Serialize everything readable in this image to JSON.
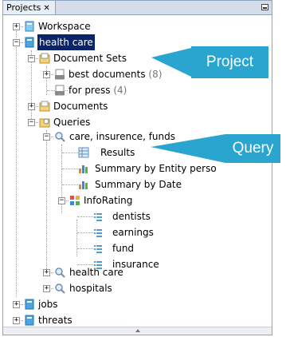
{
  "panel": {
    "tab_label": "Projects",
    "close_glyph": "✕"
  },
  "tree": {
    "workspace": "Workspace",
    "health_care": "health care",
    "document_sets": "Document Sets",
    "best_documents": "best documents",
    "best_documents_count": "(8)",
    "for_press": "for press",
    "for_press_count": "(4)",
    "documents": "Documents",
    "queries": "Queries",
    "query_name": "care, insurence, funds",
    "results": "Results",
    "summary_entity": "Summary by Entity perso",
    "summary_date": "Summary by Date",
    "inforating": "InfoRating",
    "dentists": "dentists",
    "earnings": "earnings",
    "fund": "fund",
    "insurance": "insurance",
    "query_health_care": "health care",
    "query_hospitals": "hospitals",
    "jobs": "jobs",
    "threats": "threats"
  },
  "callouts": {
    "project": "Project",
    "query": "Query"
  },
  "icons": {
    "project": "project-book-icon",
    "folder": "folder-icon",
    "document_set": "document-set-icon",
    "search": "search-icon",
    "results": "table-icon",
    "chart": "bar-chart-icon",
    "inforating": "info-rating-icon",
    "rating_item": "rating-item-icon"
  },
  "colors": {
    "accent": "#2aa5cf",
    "selection": "#0a246a",
    "tab_bg": "#d4dde9"
  }
}
